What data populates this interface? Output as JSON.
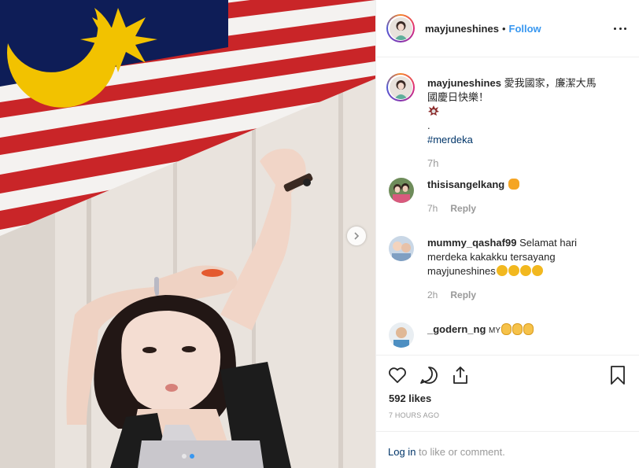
{
  "post": {
    "username": "mayjuneshines",
    "separator": "•",
    "follow_label": "Follow"
  },
  "caption": {
    "username": "mayjuneshines",
    "line1": "愛我國家，廉潔大馬",
    "line2": "國慶日快樂！",
    "dot": ".",
    "hashtag": "#merdeka",
    "time": "7h"
  },
  "comments": [
    {
      "username": "thisisangelkang",
      "text": "",
      "emoji": [
        "tiger-face"
      ],
      "time": "7h",
      "reply_label": "Reply"
    },
    {
      "username": "mummy_qashaf99",
      "text": "Selamat hari merdeka kakakku tersayang mayjuneshines",
      "emoji": [
        "face-tongue",
        "face-tongue",
        "face-tongue",
        "face-kiss-heart"
      ],
      "time": "2h",
      "reply_label": "Reply"
    },
    {
      "username": "_godern_ng",
      "text": "MY",
      "emoji": [
        "clap",
        "clap",
        "clap"
      ]
    }
  ],
  "likes": "592 likes",
  "timestamp": "7 HOURS AGO",
  "login": {
    "link": "Log in",
    "text": " to like or comment."
  },
  "carousel": {
    "total": 2,
    "current": 2
  },
  "colors": {
    "accent": "#3897f0",
    "flag_red": "#d42a2a",
    "flag_blue": "#0f1f5c",
    "flag_yellow": "#f7c400"
  }
}
